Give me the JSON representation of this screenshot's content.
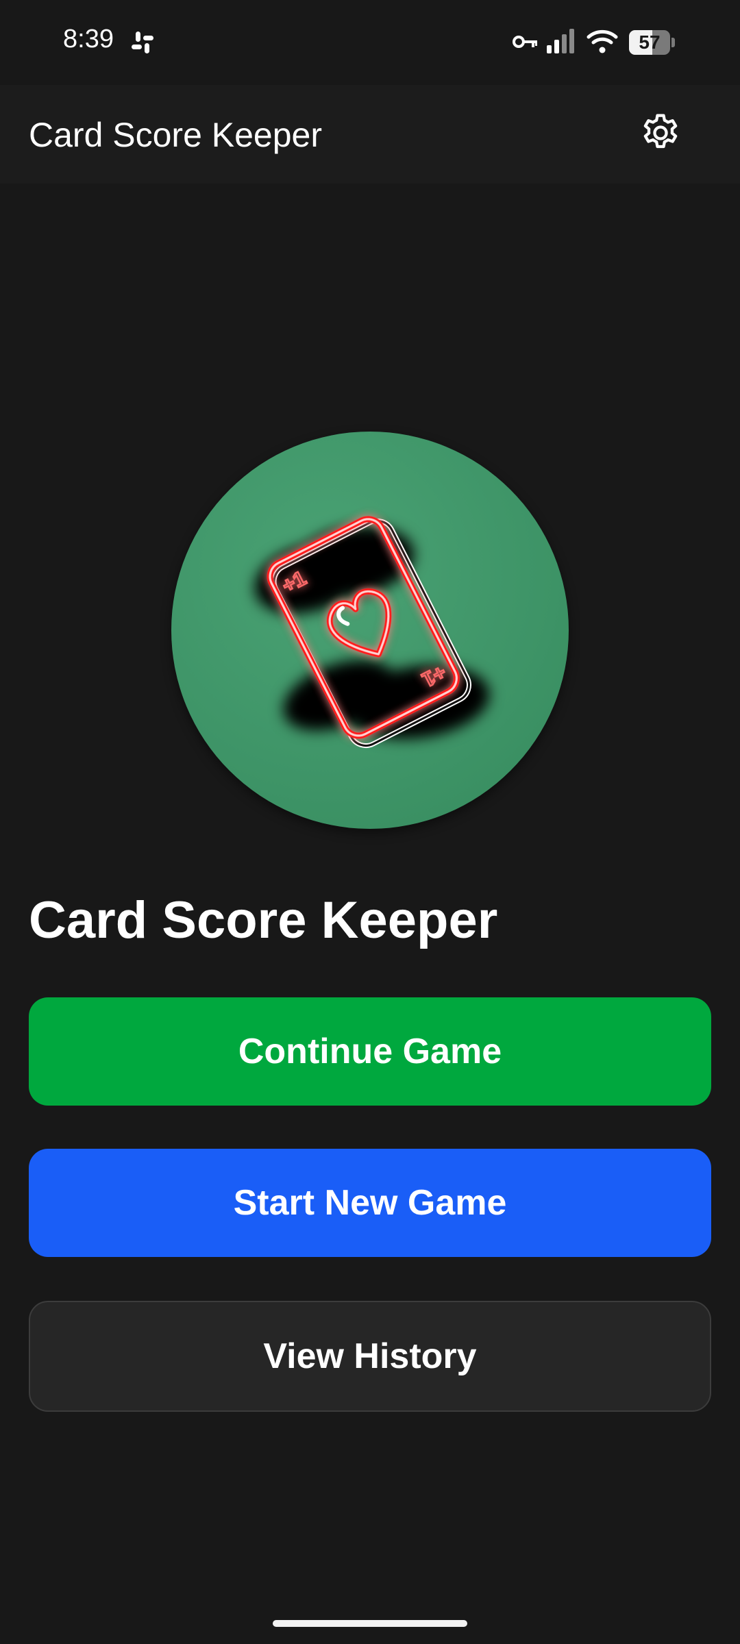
{
  "status_bar": {
    "time": "8:39",
    "battery": "57",
    "battery_level": 0.57,
    "icons": [
      "slack-icon",
      "vpn-key-icon",
      "cellular-signal-icon",
      "wifi-icon",
      "battery-icon"
    ]
  },
  "app_bar": {
    "title": "Card Score Keeper",
    "settings_icon": "gear-icon"
  },
  "logo": {
    "icon": "neon-heart-playing-card-icon",
    "corner_top": "+1",
    "corner_bottom": "+1",
    "background_color": "#3e9467",
    "neon_color": "#ff1a1a"
  },
  "main": {
    "title": "Card Score Keeper",
    "buttons": {
      "continue": "Continue Game",
      "new_game": "Start New Game",
      "history": "View History"
    }
  },
  "colors": {
    "background": "#181818",
    "app_bar": "#1c1c1c",
    "continue": "#00a83e",
    "new_game": "#1a5ef7",
    "history": "#262626"
  }
}
